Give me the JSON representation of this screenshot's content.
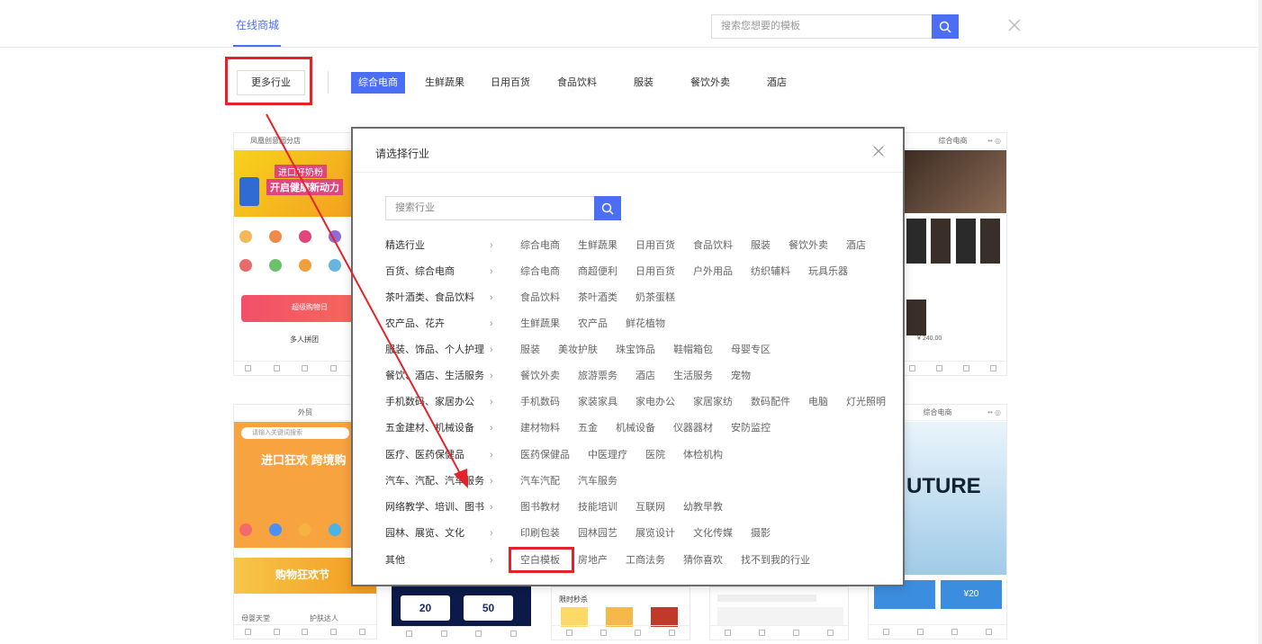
{
  "header": {
    "nav_tab": "在线商城",
    "search_placeholder": "搜索您想要的模板"
  },
  "category_bar": {
    "more_label": "更多行业",
    "categories": [
      "综合电商",
      "生鲜蔬果",
      "日用百货",
      "食品饮料",
      "服装",
      "餐饮外卖",
      "酒店"
    ],
    "active_index": 0
  },
  "colors": {
    "accent": "#4c6ef5",
    "highlight_red": "#e32229"
  },
  "modal": {
    "title": "请选择行业",
    "search_placeholder": "搜索行业",
    "rows": [
      {
        "label": "精选行业",
        "items": [
          "综合电商",
          "生鲜蔬果",
          "日用百货",
          "食品饮料",
          "服装",
          "餐饮外卖",
          "酒店"
        ]
      },
      {
        "label": "百货、综合电商",
        "items": [
          "综合电商",
          "商超便利",
          "日用百货",
          "户外用品",
          "纺织辅料",
          "玩具乐器"
        ]
      },
      {
        "label": "茶叶酒类、食品饮料",
        "items": [
          "食品饮料",
          "茶叶酒类",
          "奶茶蛋糕"
        ]
      },
      {
        "label": "农产品、花卉",
        "items": [
          "生鲜蔬果",
          "农产品",
          "鲜花植物"
        ]
      },
      {
        "label": "服装、饰品、个人护理",
        "items": [
          "服装",
          "美妆护肤",
          "珠宝饰品",
          "鞋帽箱包",
          "母婴专区"
        ]
      },
      {
        "label": "餐饮、酒店、生活服务",
        "items": [
          "餐饮外卖",
          "旅游票务",
          "酒店",
          "生活服务",
          "宠物"
        ]
      },
      {
        "label": "手机数码、家居办公",
        "items": [
          "手机数码",
          "家装家具",
          "家电办公",
          "家居家纺",
          "数码配件",
          "电脑",
          "灯光照明"
        ]
      },
      {
        "label": "五金建材、机械设备",
        "items": [
          "建材物料",
          "五金",
          "机械设备",
          "仪器器材",
          "安防监控"
        ]
      },
      {
        "label": "医疗、医药保健品",
        "items": [
          "医药保健品",
          "中医理疗",
          "医院",
          "体检机构"
        ]
      },
      {
        "label": "汽车、汽配、汽车服务",
        "items": [
          "汽车汽配",
          "汽车服务"
        ]
      },
      {
        "label": "网络教学、培训、图书",
        "items": [
          "图书教材",
          "技能培训",
          "互联网",
          "幼教早教"
        ]
      },
      {
        "label": "园林、展览、文化",
        "items": [
          "印刷包装",
          "园林园艺",
          "展览设计",
          "文化传媒",
          "摄影"
        ]
      },
      {
        "label": "其他",
        "items": [
          "空白模板",
          "房地产",
          "工商法务",
          "猜你喜欢",
          "找不到我的行业"
        ]
      }
    ]
  },
  "cards": {
    "top_left_location": "凤凰创意园分店",
    "top_left_banner_line1": "进口好奶粉",
    "top_left_banner_line2": "开启健康新动力",
    "top_left_promo": "超级购物日",
    "top_left_section": "多人拼团",
    "top_right_header": "综合电商",
    "top_right_price": "¥ 240.00",
    "bottom_left_header": "外贸",
    "bottom_left_search": "请输入关键词搜索",
    "bottom_left_banner": "进口狂欢 跨境购",
    "bottom_left_promo": "购物狂欢节",
    "bottom_left_store1": "母婴天堂",
    "bottom_left_store2": "护肤达人",
    "bottom_mid_coupon1": "20",
    "bottom_mid_coupon2": "50",
    "bottom_mid3_label": "限时秒杀",
    "bottom_right_header": "综合电商",
    "bottom_right_banner": "UTURE",
    "bottom_right_coupon": "¥20"
  }
}
